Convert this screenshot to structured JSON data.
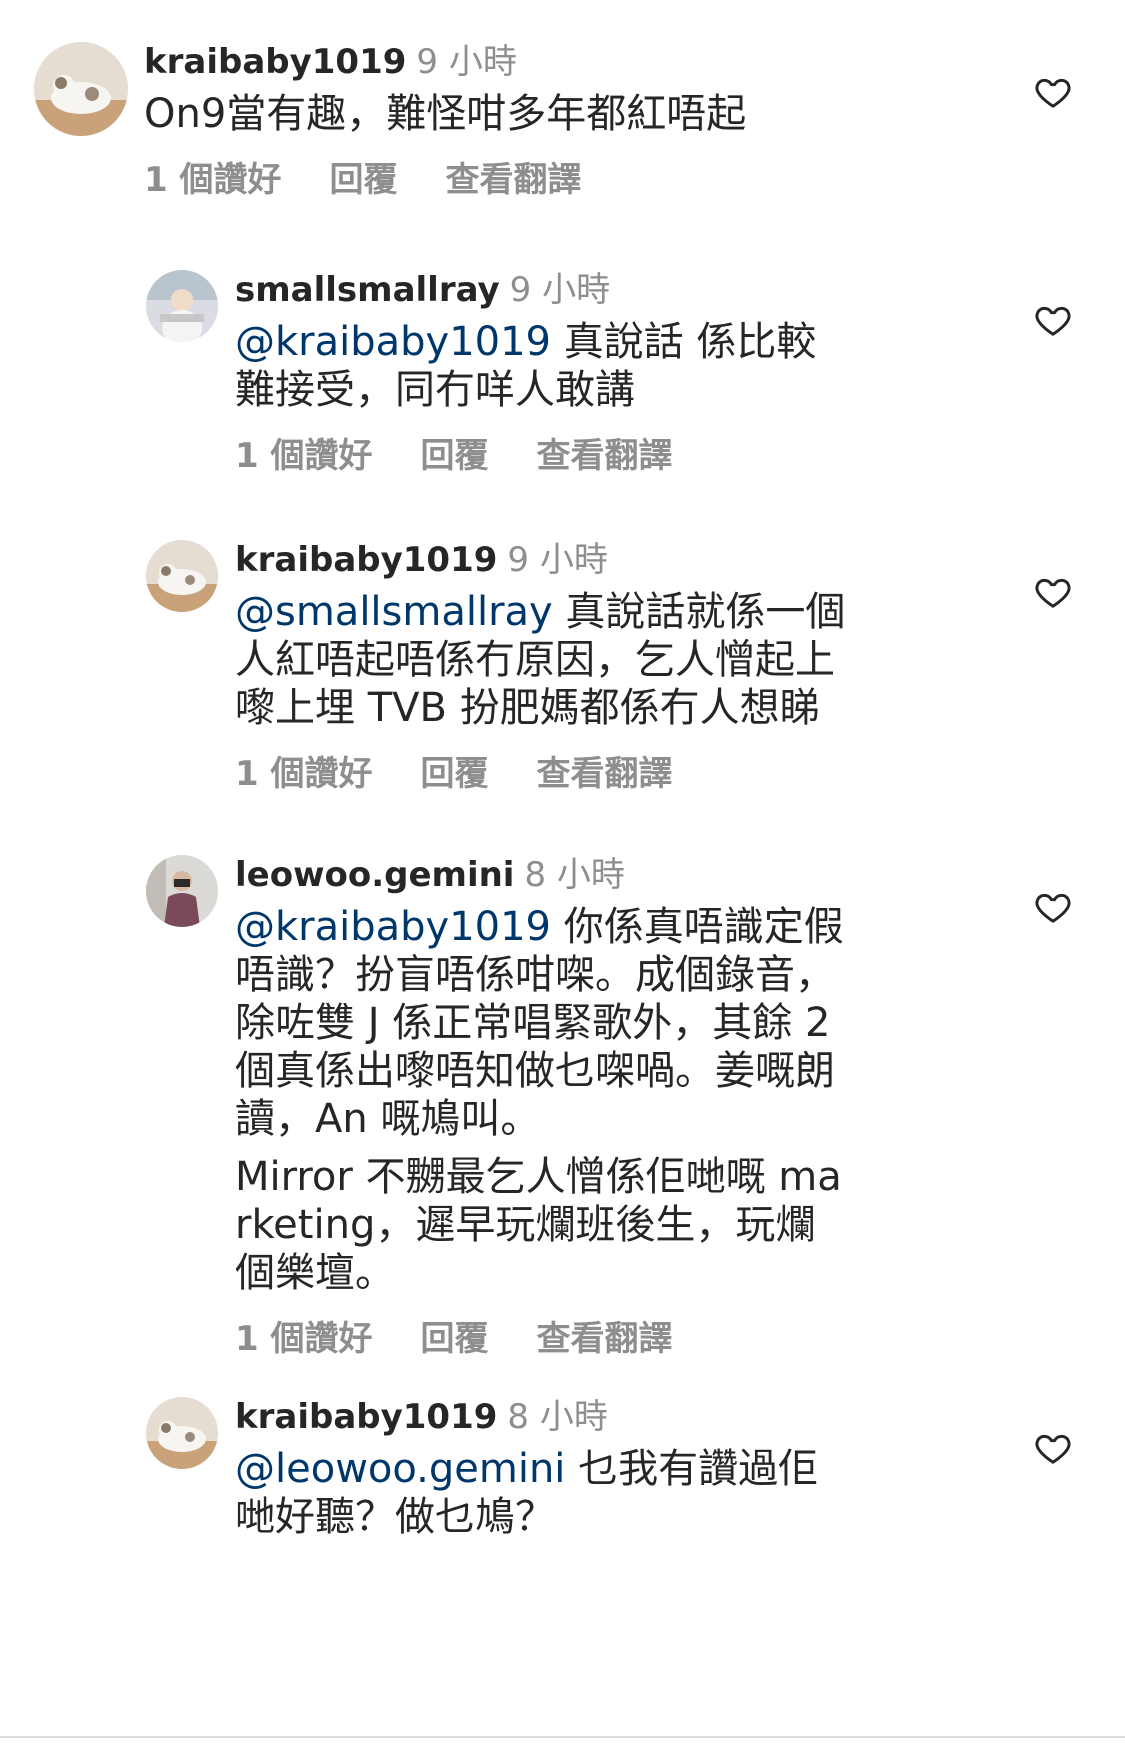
{
  "comments": [
    {
      "username": "kraibaby1019",
      "time": "9 小時",
      "mention": "",
      "text": "On9當有趣，難怪咁多年都紅唔起",
      "text2": "",
      "likes": "1 個讚好",
      "reply": "回覆",
      "translate": "查看翻譯"
    },
    {
      "username": "smallsmallray",
      "time": "9 小時",
      "mention": "@kraibaby1019",
      "text": " 真說話 係比較難接受，同冇咩人敢講",
      "text2": "",
      "likes": "1 個讚好",
      "reply": "回覆",
      "translate": "查看翻譯"
    },
    {
      "username": "kraibaby1019",
      "time": "9 小時",
      "mention": "@smallsmallray",
      "text": " 真說話就係一個人紅唔起唔係冇原因，乞人憎起上嚟上埋 TVB 扮肥媽都係冇人想睇",
      "text2": "",
      "likes": "1 個讚好",
      "reply": "回覆",
      "translate": "查看翻譯"
    },
    {
      "username": "leowoo.gemini",
      "time": "8 小時",
      "mention": "@kraibaby1019",
      "text": " 你係真唔識定假唔識？扮盲唔係咁㗎。成個錄音，除咗雙 J 係正常唱緊歌外，其餘 2 個真係出嚟唔知做乜㗎喎。姜嘅朗讀，An 嘅鳩叫。",
      "text2": "Mirror 不嬲最乞人憎係佢哋嘅 marketing，遲早玩爛班後生，玩爛個樂壇。",
      "likes": "1 個讚好",
      "reply": "回覆",
      "translate": "查看翻譯"
    },
    {
      "username": "kraibaby1019",
      "time": "8 小時",
      "mention": "@leowoo.gemini",
      "text": " 乜我有讚過佢哋好聽？做乜鳩？",
      "text2": "",
      "likes": "",
      "reply": "",
      "translate": ""
    }
  ],
  "colors": {
    "text": "#262626",
    "secondary": "#8e8e8e",
    "mention": "#00376b"
  },
  "icons": {
    "like": "heart-outline-icon"
  }
}
